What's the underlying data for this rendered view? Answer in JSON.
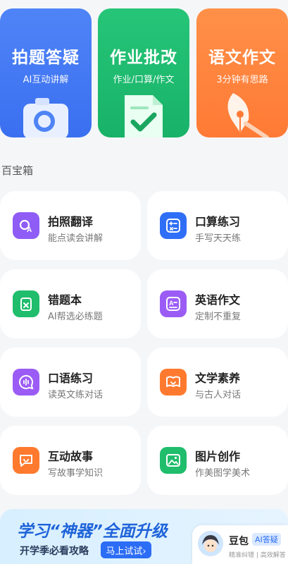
{
  "feature_cards": [
    {
      "title": "拍题答疑",
      "subtitle": "AI互动讲解"
    },
    {
      "title": "作业批改",
      "subtitle": "作业/口算/作文"
    },
    {
      "title": "语文作文",
      "subtitle": "3分钟有思路"
    }
  ],
  "toolbox": {
    "title": "百宝箱",
    "items": [
      {
        "name": "拍照翻译",
        "desc": "能点读会讲解"
      },
      {
        "name": "口算练习",
        "desc": "手写天天练"
      },
      {
        "name": "错题本",
        "desc": "AI帮选必练题"
      },
      {
        "name": "英语作文",
        "desc": "定制不重复"
      },
      {
        "name": "口语练习",
        "desc": "读英文练对话"
      },
      {
        "name": "文学素养",
        "desc": "与古人对话"
      },
      {
        "name": "互动故事",
        "desc": "写故事学知识"
      },
      {
        "name": "图片创作",
        "desc": "作美图学美术"
      }
    ]
  },
  "banner": {
    "title": "学习“神器”全面升级",
    "subtitle": "开学季必看攻略",
    "button": "马上试试›"
  },
  "assistant": {
    "name": "豆包",
    "tag": "AI答疑",
    "subtitle": "精准纠错 | 高效解答"
  }
}
